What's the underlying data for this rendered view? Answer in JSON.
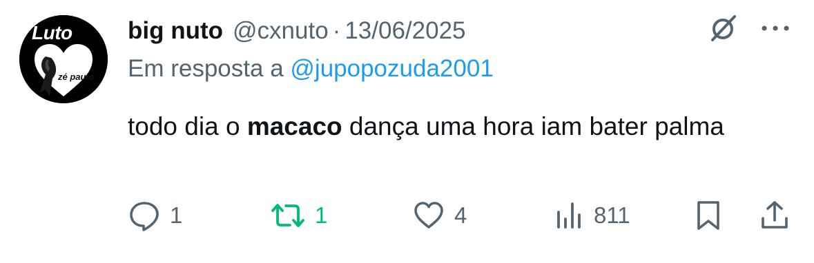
{
  "tweet": {
    "avatar": {
      "badge_text": "Luto",
      "name_text": "zé paulo"
    },
    "author": {
      "display_name": "big nuto",
      "handle": "@cxnuto",
      "separator": "·",
      "date": "13/06/2025"
    },
    "reply_to": {
      "prefix": "Em resposta a",
      "mention": "@jupopozuda2001"
    },
    "text": {
      "before": "todo dia o ",
      "bold": "macaco",
      "after": " dança uma hora iam bater palma"
    }
  },
  "actions": {
    "replies": "1",
    "retweets": "1",
    "likes": "4",
    "views": "811"
  },
  "colors": {
    "text": "#0f1419",
    "secondary": "#536471",
    "link": "#1d9bf0",
    "retweet": "#00ba7c"
  },
  "icons": [
    "grok-icon",
    "more-icon",
    "reply-icon",
    "retweet-icon",
    "like-icon",
    "views-icon",
    "bookmark-icon",
    "share-icon"
  ]
}
